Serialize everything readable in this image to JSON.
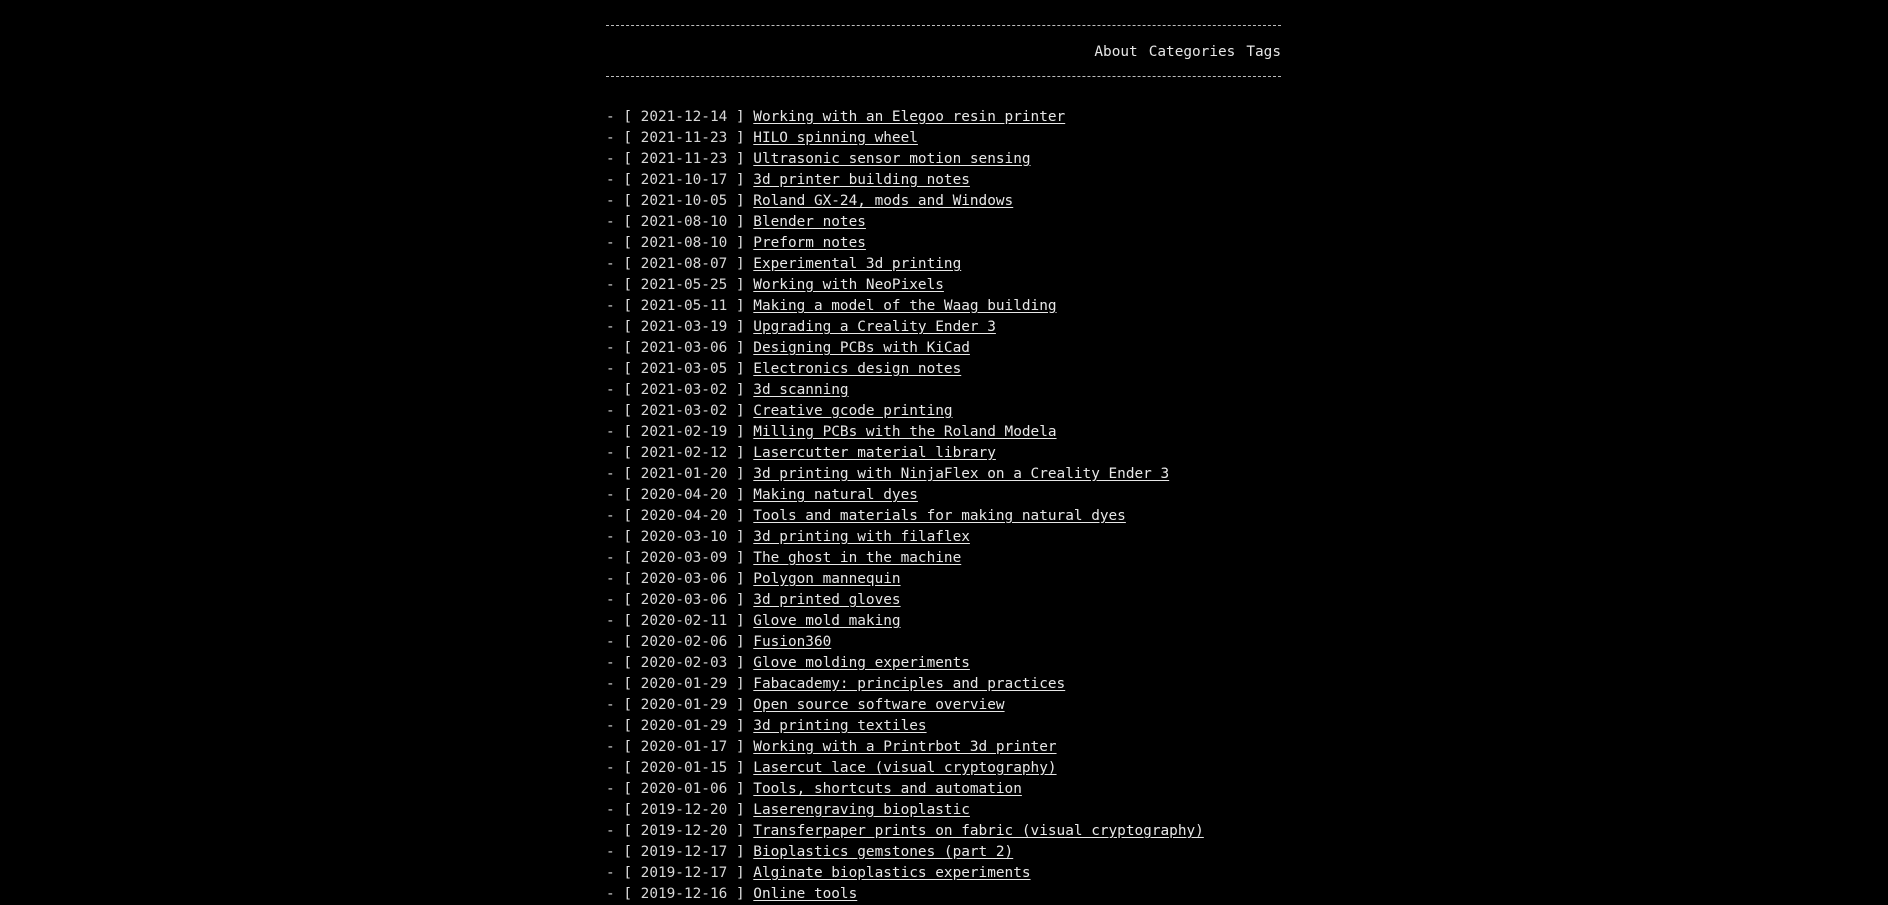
{
  "nav": {
    "about": "About",
    "categories": "Categories",
    "tags": "Tags"
  },
  "posts": [
    {
      "date": "2021-12-14",
      "title": "Working with an Elegoo resin printer"
    },
    {
      "date": "2021-11-23",
      "title": "HILO spinning wheel"
    },
    {
      "date": "2021-11-23",
      "title": "Ultrasonic sensor motion sensing"
    },
    {
      "date": "2021-10-17",
      "title": "3d printer building notes"
    },
    {
      "date": "2021-10-05",
      "title": "Roland GX-24, mods and Windows"
    },
    {
      "date": "2021-08-10",
      "title": "Blender notes"
    },
    {
      "date": "2021-08-10",
      "title": "Preform notes"
    },
    {
      "date": "2021-08-07",
      "title": "Experimental 3d printing"
    },
    {
      "date": "2021-05-25",
      "title": "Working with NeoPixels"
    },
    {
      "date": "2021-05-11",
      "title": "Making a model of the Waag building"
    },
    {
      "date": "2021-03-19",
      "title": "Upgrading a Creality Ender 3"
    },
    {
      "date": "2021-03-06",
      "title": "Designing PCBs with KiCad"
    },
    {
      "date": "2021-03-05",
      "title": "Electronics design notes"
    },
    {
      "date": "2021-03-02",
      "title": "3d scanning"
    },
    {
      "date": "2021-03-02",
      "title": "Creative gcode printing"
    },
    {
      "date": "2021-02-19",
      "title": "Milling PCBs with the Roland Modela"
    },
    {
      "date": "2021-02-12",
      "title": "Lasercutter material library"
    },
    {
      "date": "2021-01-20",
      "title": "3d printing with NinjaFlex on a Creality Ender 3"
    },
    {
      "date": "2020-04-20",
      "title": "Making natural dyes"
    },
    {
      "date": "2020-04-20",
      "title": "Tools and materials for making natural dyes"
    },
    {
      "date": "2020-03-10",
      "title": "3d printing with filaflex"
    },
    {
      "date": "2020-03-09",
      "title": "The ghost in the machine"
    },
    {
      "date": "2020-03-06",
      "title": "Polygon mannequin"
    },
    {
      "date": "2020-03-06",
      "title": "3d printed gloves"
    },
    {
      "date": "2020-02-11",
      "title": "Glove mold making"
    },
    {
      "date": "2020-02-06",
      "title": "Fusion360"
    },
    {
      "date": "2020-02-03",
      "title": "Glove molding experiments"
    },
    {
      "date": "2020-01-29",
      "title": "Fabacademy: principles and practices"
    },
    {
      "date": "2020-01-29",
      "title": "Open source software overview"
    },
    {
      "date": "2020-01-29",
      "title": "3d printing textiles"
    },
    {
      "date": "2020-01-17",
      "title": "Working with a Printrbot 3d printer"
    },
    {
      "date": "2020-01-15",
      "title": "Lasercut lace (visual cryptography)"
    },
    {
      "date": "2020-01-06",
      "title": "Tools, shortcuts and automation"
    },
    {
      "date": "2019-12-20",
      "title": "Laserengraving bioplastic"
    },
    {
      "date": "2019-12-20",
      "title": "Transferpaper prints on fabric (visual cryptography)"
    },
    {
      "date": "2019-12-17",
      "title": "Bioplastics gemstones (part 2)"
    },
    {
      "date": "2019-12-17",
      "title": "Alginate bioplastics experiments"
    },
    {
      "date": "2019-12-16",
      "title": "Online tools"
    }
  ]
}
